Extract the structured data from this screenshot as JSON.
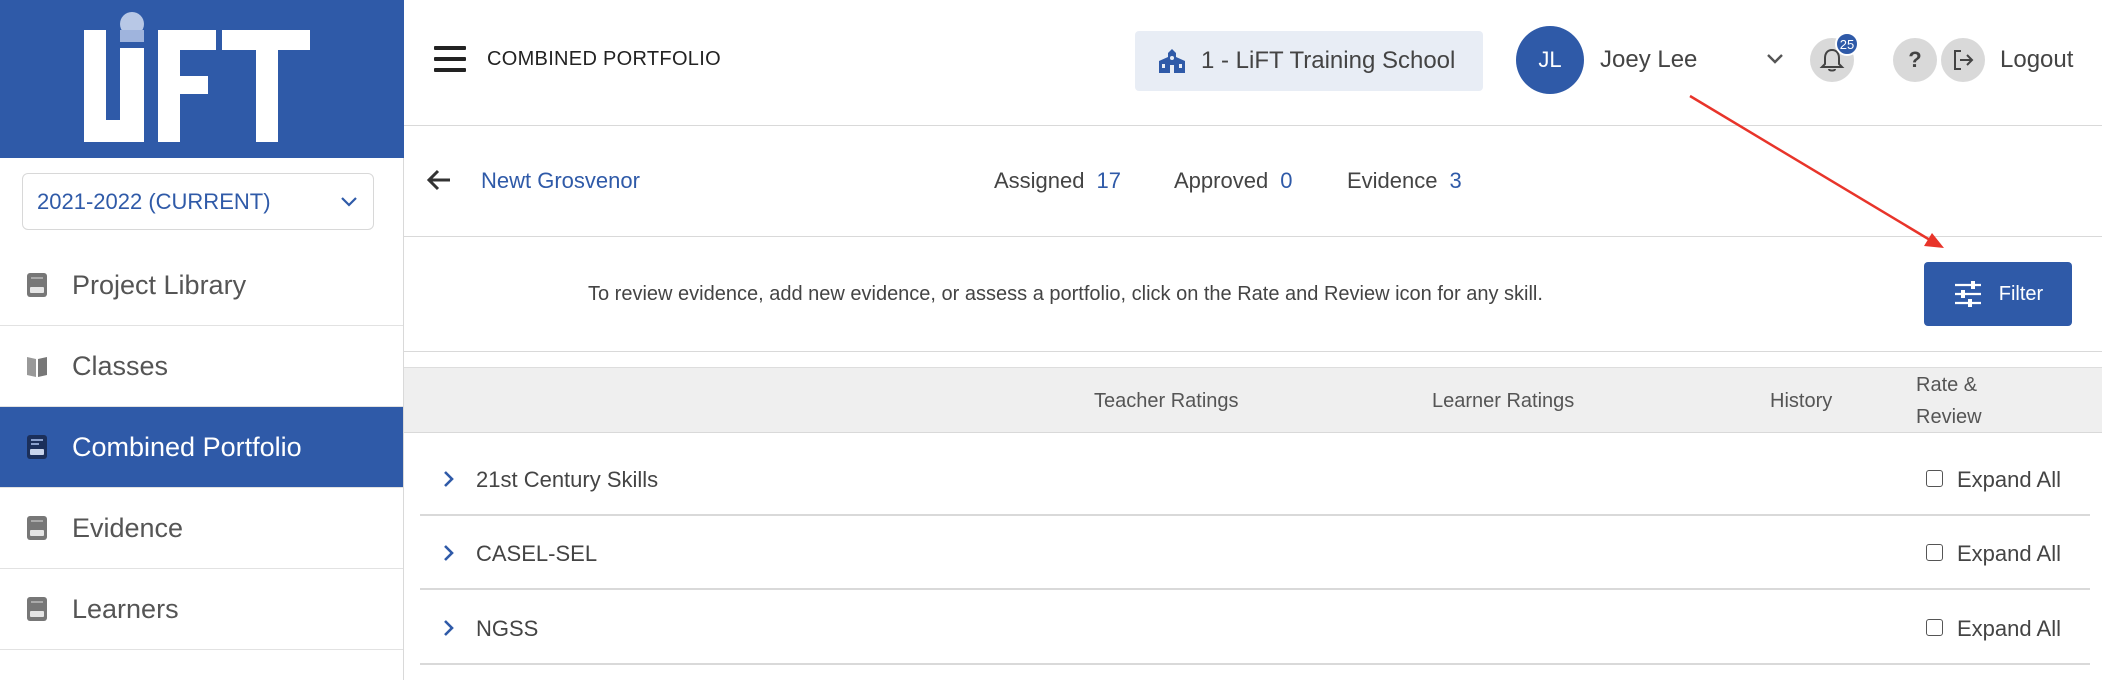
{
  "app": {
    "logo_text": "LiFT"
  },
  "sidebar": {
    "year": "2021-2022 (CURRENT)",
    "items": [
      {
        "label": "Project Library"
      },
      {
        "label": "Classes"
      },
      {
        "label": "Combined Portfolio"
      },
      {
        "label": "Evidence"
      },
      {
        "label": "Learners"
      }
    ]
  },
  "header": {
    "title": "COMBINED PORTFOLIO",
    "school": "1 - LiFT Training School",
    "avatar_initials": "JL",
    "user_name": "Joey Lee",
    "notification_count": "25",
    "help": "?",
    "logout_label": "Logout"
  },
  "student": {
    "name": "Newt Grosvenor",
    "assigned_label": "Assigned",
    "assigned_value": "17",
    "approved_label": "Approved",
    "approved_value": "0",
    "evidence_label": "Evidence",
    "evidence_value": "3"
  },
  "info": {
    "text": "To review evidence, add new evidence, or assess a portfolio, click on the Rate and Review icon for any skill.",
    "filter_label": "Filter"
  },
  "table": {
    "headers": {
      "teacher": "Teacher Ratings",
      "learner": "Learner Ratings",
      "history": "History",
      "rate1": "Rate &",
      "rate2": "Review"
    },
    "rows": [
      {
        "label": "21st Century Skills",
        "expand": "Expand All"
      },
      {
        "label": "CASEL-SEL",
        "expand": "Expand All"
      },
      {
        "label": "NGSS",
        "expand": "Expand All"
      }
    ]
  },
  "colors": {
    "brand": "#2f5aa8",
    "annotation": "#e8342a"
  },
  "icons": [
    "book-icon",
    "hamburger-icon",
    "school-icon",
    "chevron-down-icon",
    "bell-icon",
    "logout-icon",
    "back-arrow-icon",
    "filter-sliders-icon",
    "chevron-right-icon"
  ]
}
